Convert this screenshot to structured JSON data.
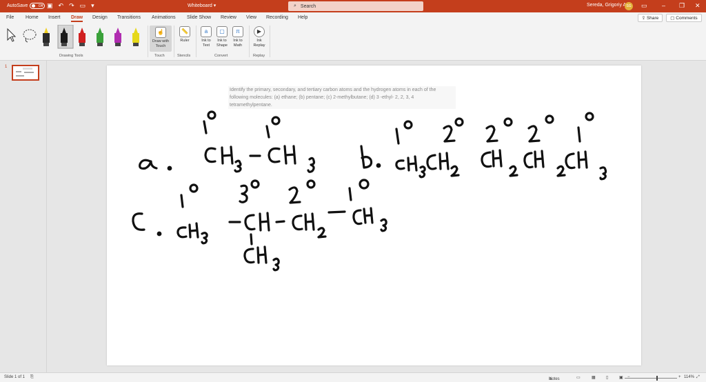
{
  "titlebar": {
    "autosave_label": "AutoSave",
    "autosave_state": "Off",
    "doc_title": "Whiteboard",
    "search_placeholder": "Search",
    "user_name": "Sereda, Grigoriy A",
    "user_initials": "SG"
  },
  "menu": {
    "items": [
      "File",
      "Home",
      "Insert",
      "Draw",
      "Design",
      "Transitions",
      "Animations",
      "Slide Show",
      "Review",
      "View",
      "Recording",
      "Help"
    ],
    "active": "Draw",
    "share": "Share",
    "comments": "Comments"
  },
  "ribbon": {
    "groups": {
      "drawing_tools": "Drawing Tools",
      "touch": "Touch",
      "stencils": "Stencils",
      "convert": "Convert",
      "replay": "Replay"
    },
    "buttons": {
      "draw_with_touch": "Draw with Touch",
      "ruler": "Ruler",
      "ink_to_text": "Ink to Text",
      "ink_to_shape": "Ink to Shape",
      "ink_to_math": "Ink to Math",
      "ink_replay": "Ink Replay"
    },
    "pens": [
      {
        "color": "#2b2b2b",
        "tip": "#f0d020"
      },
      {
        "color": "#1a1a1a",
        "tip": "#1a1a1a"
      },
      {
        "color": "#d02020",
        "tip": "#d02020"
      },
      {
        "color": "#3aa13a",
        "tip": "#3aa13a"
      },
      {
        "color": "#b02cb0",
        "tip": "#b02cb0"
      },
      {
        "color": "#e6d81a",
        "tip": "#e6d81a"
      }
    ]
  },
  "slides": {
    "current_number": "1"
  },
  "slide": {
    "prompt_text": "Identify the primary, secondary, and tertiary carbon atoms and the hydrogen atoms in each of the following molecules: (a) ethane; (b) pentane; (c) 2-methylbutane; (d) 3 -ethyl- 2, 2, 3, 4 tetramethylpentane."
  },
  "status": {
    "slide_info": "Slide 1 of 1",
    "notes": "Notes",
    "zoom": "114%"
  }
}
